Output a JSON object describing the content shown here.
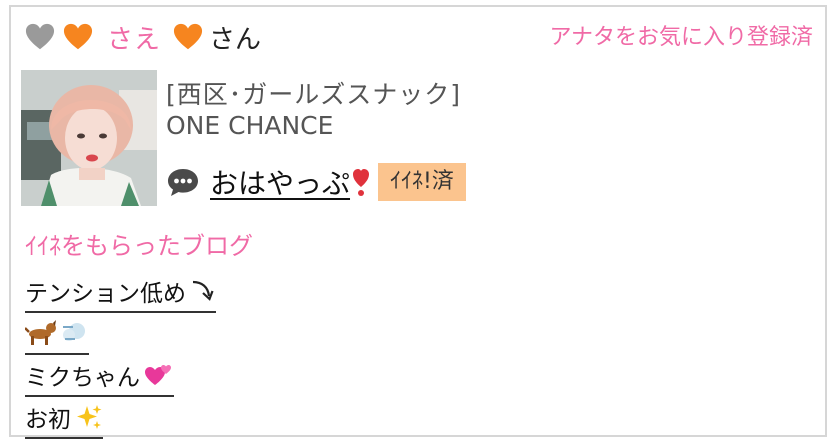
{
  "header": {
    "heart_gray_icon": "heart-gray-icon",
    "heart_orange_icon": "heart-orange-icon",
    "user_name": "さえ",
    "honorific": "さん",
    "favorite_status": "アナタをお気に入り登録済"
  },
  "profile": {
    "category": "[西区･ガールズスナック]",
    "shop_name": "ONE CHANCE",
    "greeting": "おはやっぷ",
    "iine_badge": "ｲｲﾈ!済"
  },
  "blog_section": {
    "title": "ｲｲﾈをもらったブログ",
    "items": [
      {
        "label": "テンション低め",
        "emoji": "arrow-down-icon"
      },
      {
        "label": "",
        "emoji": "dog-dash-icon"
      },
      {
        "label": "ミクちゃん",
        "emoji": "two-hearts-icon"
      },
      {
        "label": "お初",
        "emoji": "sparkles-icon"
      }
    ]
  },
  "colors": {
    "pink": "#f06aa6",
    "orange_heart": "#f6851f",
    "gray_heart": "#9a9a9a",
    "badge_bg": "#fbc48e",
    "border": "#d6d6d6"
  }
}
